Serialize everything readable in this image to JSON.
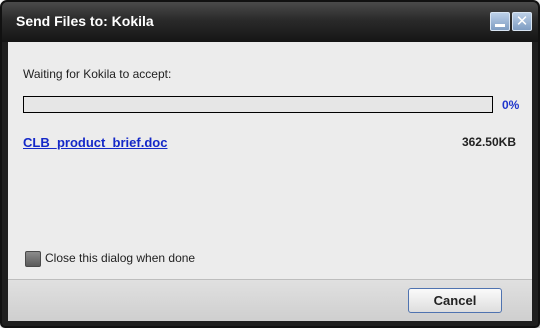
{
  "window": {
    "title": "Send Files to: Kokila"
  },
  "transfer": {
    "status_text": "Waiting for Kokila to accept:",
    "progress_percent": 0,
    "progress_label": "0%",
    "file_name": "CLB_product_brief.doc",
    "file_size": "362.50KB"
  },
  "options": {
    "close_when_done_label": "Close this dialog when done",
    "close_when_done_checked": false
  },
  "footer": {
    "cancel_label": "Cancel"
  },
  "icons": {
    "minimize": "minimize-icon",
    "close": "close-icon"
  },
  "colors": {
    "titlebar": "#2a2a2a",
    "link": "#1428c8",
    "progress_label": "#1f35cc",
    "button_border": "#4f73b0"
  }
}
